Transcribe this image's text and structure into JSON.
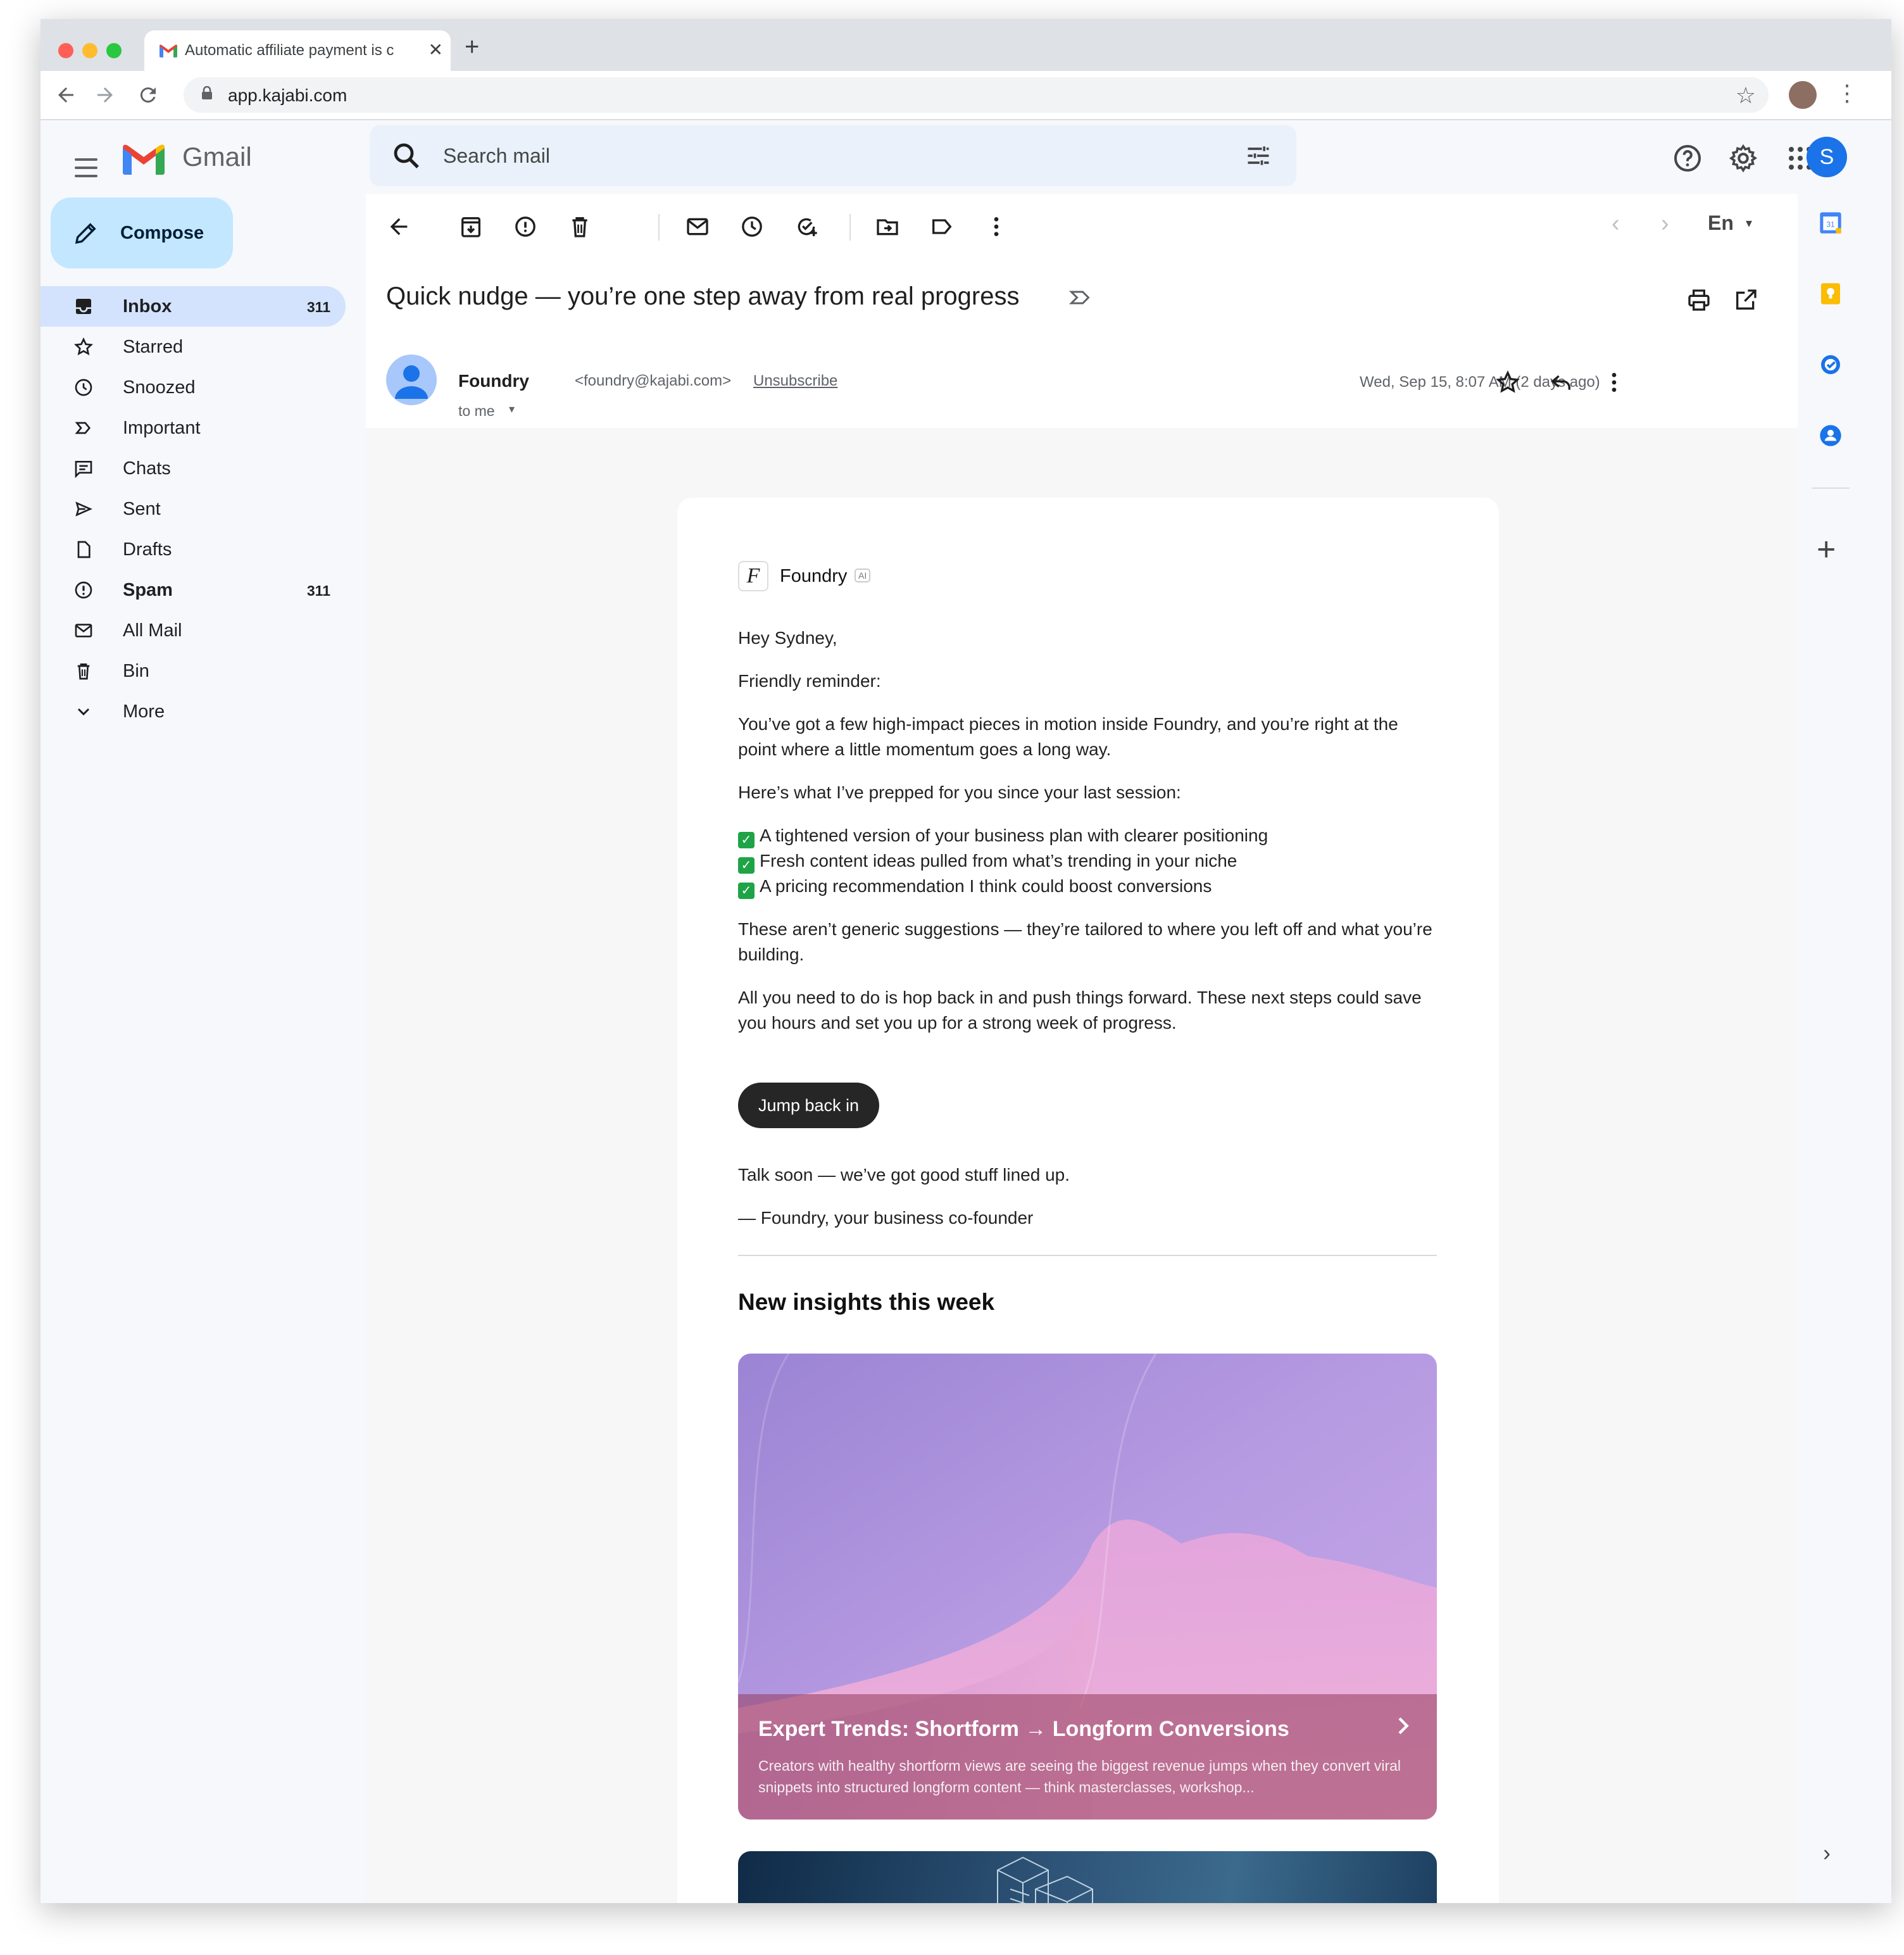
{
  "browser": {
    "tab_title": "Automatic affiliate payment is c",
    "url": "app.kajabi.com"
  },
  "gmail": {
    "product_name": "Gmail",
    "search_placeholder": "Search mail",
    "account_initial": "S"
  },
  "compose_label": "Compose",
  "sidebar": {
    "items": [
      {
        "label": "Inbox",
        "count": "311",
        "icon": "inbox-icon"
      },
      {
        "label": "Starred",
        "count": "",
        "icon": "star-icon"
      },
      {
        "label": "Snoozed",
        "count": "",
        "icon": "clock-icon"
      },
      {
        "label": "Important",
        "count": "",
        "icon": "important-icon"
      },
      {
        "label": "Chats",
        "count": "",
        "icon": "chat-icon"
      },
      {
        "label": "Sent",
        "count": "",
        "icon": "send-icon"
      },
      {
        "label": "Drafts",
        "count": "",
        "icon": "draft-icon"
      },
      {
        "label": "Spam",
        "count": "311",
        "icon": "spam-icon"
      },
      {
        "label": "All Mail",
        "count": "",
        "icon": "mail-icon"
      },
      {
        "label": "Bin",
        "count": "",
        "icon": "trash-icon"
      },
      {
        "label": "More",
        "count": "",
        "icon": "chevron-down-icon"
      }
    ]
  },
  "toolbar": {
    "language": "En"
  },
  "message": {
    "subject": "Quick nudge — you’re one step away from real progress",
    "sender_name": "Foundry",
    "sender_email": "<foundry@kajabi.com>",
    "unsubscribe": "Unsubscribe",
    "recipient": "to me",
    "date": "Wed, Sep 15, 8:07 AM (2 days ago)"
  },
  "email_body": {
    "brand_mark": "F",
    "brand_name": "Foundry",
    "brand_badge": "AI",
    "greeting": "Hey Sydney,",
    "reminder": "Friendly reminder:",
    "para1": "You’ve got a few high-impact pieces in motion inside Foundry, and you’re right at the point where a little momentum goes a long way.",
    "para2": "Here’s what I’ve prepped for you since your last session:",
    "checklist": [
      "A tightened version of your business plan with clearer positioning",
      "Fresh content ideas pulled from what’s trending in your niche",
      "A pricing recommendation I think could boost conversions"
    ],
    "para3": "These aren’t generic suggestions — they’re tailored to where you left off and what you’re building.",
    "para4": "All you need to do is hop back in and push things forward. These next steps could save you hours and set you up for a strong week of progress.",
    "cta_label": "Jump back in",
    "signoff1": "Talk soon — we’ve got good stuff lined up.",
    "signoff2": "— Foundry, your business co-founder",
    "insights_heading": "New insights this week",
    "insight_card": {
      "title": "Expert Trends: Shortform → Longform Conversions",
      "description": "Creators with healthy shortform views are seeing the biggest revenue jumps when they convert viral snippets into structured longform content — think masterclasses, workshop..."
    }
  },
  "colors": {
    "compose_bg": "#c2e7ff",
    "active_nav_bg": "#d3e3fd",
    "search_bg": "#eaf1fb",
    "account_avatar": "#1a73e8",
    "cta_bg": "#262626",
    "check_green": "#1ea446"
  }
}
